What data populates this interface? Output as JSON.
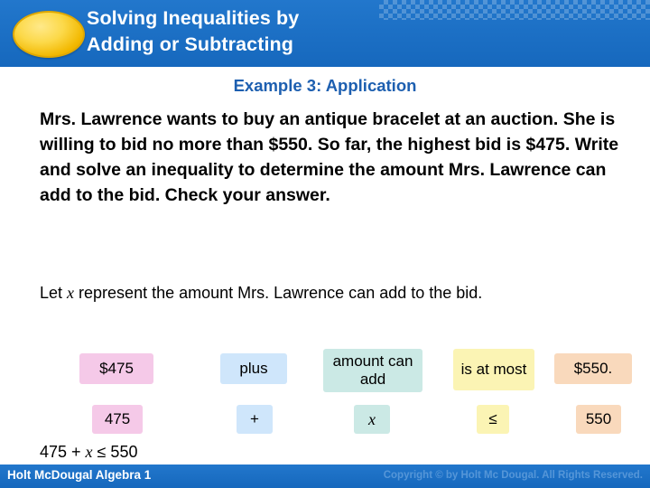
{
  "header": {
    "title_line1": "Solving Inequalities by",
    "title_line2": "Adding or Subtracting"
  },
  "example": {
    "subtitle": "Example 3: Application",
    "problem": "Mrs. Lawrence wants to buy an antique bracelet at an auction. She is willing to bid no more than $550. So far, the highest bid is $475. Write and solve an inequality to determine the amount Mrs. Lawrence can add to the bid. Check your answer.",
    "let_statement_part1": "Let ",
    "let_statement_variable": "x",
    "let_statement_part2": " represent the amount Mrs. Lawrence can add to the bid."
  },
  "translation": {
    "phrases": [
      {
        "label": "$475"
      },
      {
        "label": "plus"
      },
      {
        "label": "amount can add"
      },
      {
        "label": "is at most"
      },
      {
        "label": "$550."
      }
    ],
    "symbols": [
      {
        "label": "475"
      },
      {
        "label": "+"
      },
      {
        "label": "x"
      },
      {
        "label": "≤"
      },
      {
        "label": "550"
      }
    ]
  },
  "final": {
    "part1": "475 + ",
    "variable": "x",
    "part2": " ≤ 550"
  },
  "footer": {
    "left": "Holt McDougal Algebra 1",
    "right": "Copyright © by Holt Mc Dougal. All Rights Reserved."
  },
  "colors": {
    "header_blue": "#1d6ec4",
    "subtitle_blue": "#1d5fb0",
    "pink": "#f5c9e8",
    "light_blue": "#cfe6fb",
    "teal": "#cbe9e5",
    "yellow": "#fbf4b4",
    "peach": "#f9d9bc"
  }
}
